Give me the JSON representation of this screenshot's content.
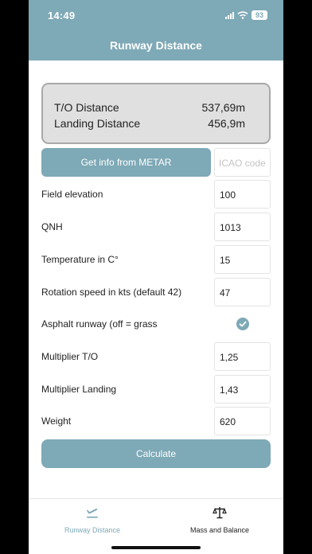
{
  "status": {
    "time": "14:49",
    "battery": "93"
  },
  "header": {
    "title": "Runway Distance"
  },
  "results": {
    "to_label": "T/O Distance",
    "to_value": "537,69m",
    "landing_label": "Landing Distance",
    "landing_value": "456,9m"
  },
  "metar": {
    "button_label": "Get info from METAR",
    "icao_placeholder": "ICAO code"
  },
  "fields": [
    {
      "label": "Field elevation",
      "value": "100"
    },
    {
      "label": "QNH",
      "value": "1013"
    },
    {
      "label": "Temperature in C°",
      "value": "15"
    },
    {
      "label": "Rotation speed in kts (default 42)",
      "value": "47"
    },
    {
      "label": "Asphalt runway (off = grass",
      "checked": true
    },
    {
      "label": "Multiplier T/O",
      "value": "1,25"
    },
    {
      "label": "Multiplier Landing",
      "value": "1,43"
    },
    {
      "label": "Weight",
      "value": "620"
    }
  ],
  "calculate": {
    "label": "Calculate"
  },
  "tabs": [
    {
      "label": "Runway Distance",
      "icon": "airplane-takeoff-icon",
      "active": true
    },
    {
      "label": "Mass and Balance",
      "icon": "scale-balance-icon",
      "active": false
    }
  ],
  "colors": {
    "accent": "#7ea9b6",
    "results_bg": "#e0e0e0"
  }
}
